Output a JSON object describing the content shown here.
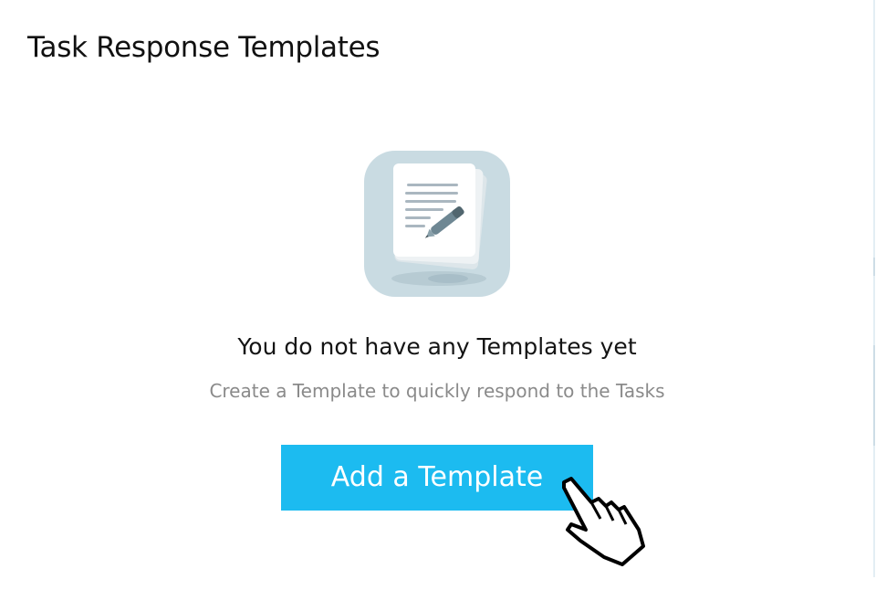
{
  "page": {
    "title": "Task Response Templates"
  },
  "empty_state": {
    "illustration_icon": "document-pen-icon",
    "title": "You do not have any Templates yet",
    "subtitle": "Create a Template to quickly respond to the Tasks"
  },
  "actions": {
    "add_template_label": "Add a Template"
  },
  "cursor": {
    "icon": "hand-pointer-icon"
  },
  "colors": {
    "accent": "#1cbbf0",
    "illustration_bg": "#c9dbe2",
    "title_text": "#111111",
    "subtitle_text": "#8a8a8a"
  }
}
